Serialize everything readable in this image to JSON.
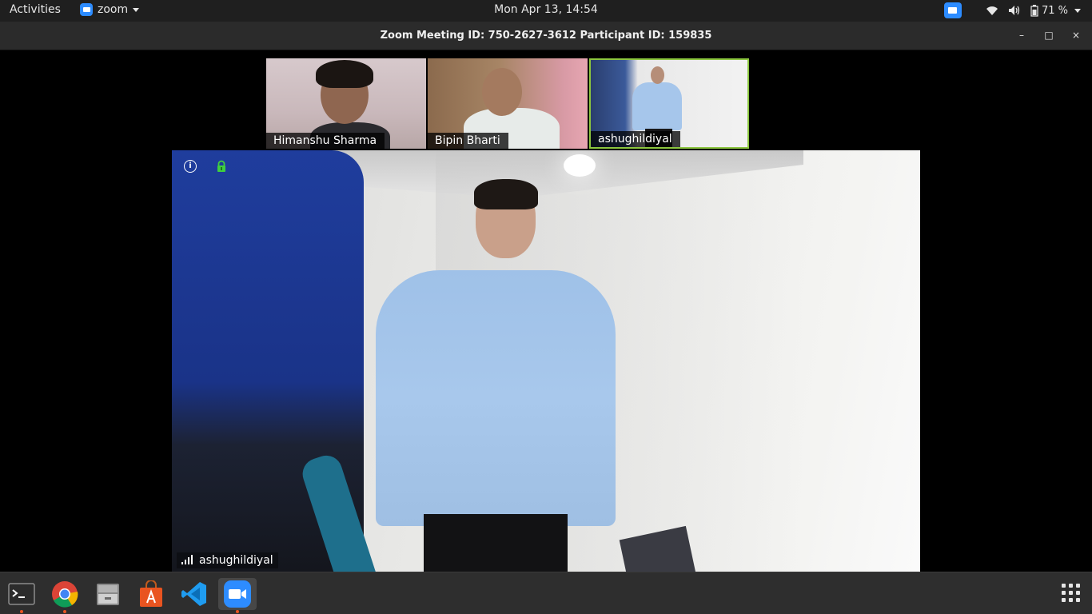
{
  "topbar": {
    "activities": "Activities",
    "app_name": "zoom",
    "clock": "Mon Apr 13, 14:54",
    "battery": "71 %"
  },
  "window": {
    "title": "Zoom Meeting ID: 750-2627-3612 Participant ID: 159835",
    "controls": {
      "minimize": "–",
      "maximize": "□",
      "close": "×"
    }
  },
  "participants": [
    {
      "name": "Himanshu Sharma"
    },
    {
      "name": "Bipin Bharti"
    },
    {
      "name": "ashughildiyal"
    }
  ],
  "main_video": {
    "speaker": "ashughildiyal",
    "info_icon": "i"
  },
  "dock": {
    "items": [
      "terminal",
      "chrome",
      "files",
      "software-center",
      "vscode",
      "zoom"
    ]
  },
  "colors": {
    "zoom_blue": "#2d8cff",
    "active_border": "#8cc63f",
    "ubuntu_orange": "#e95420",
    "lock_green": "#3fcf3f"
  }
}
